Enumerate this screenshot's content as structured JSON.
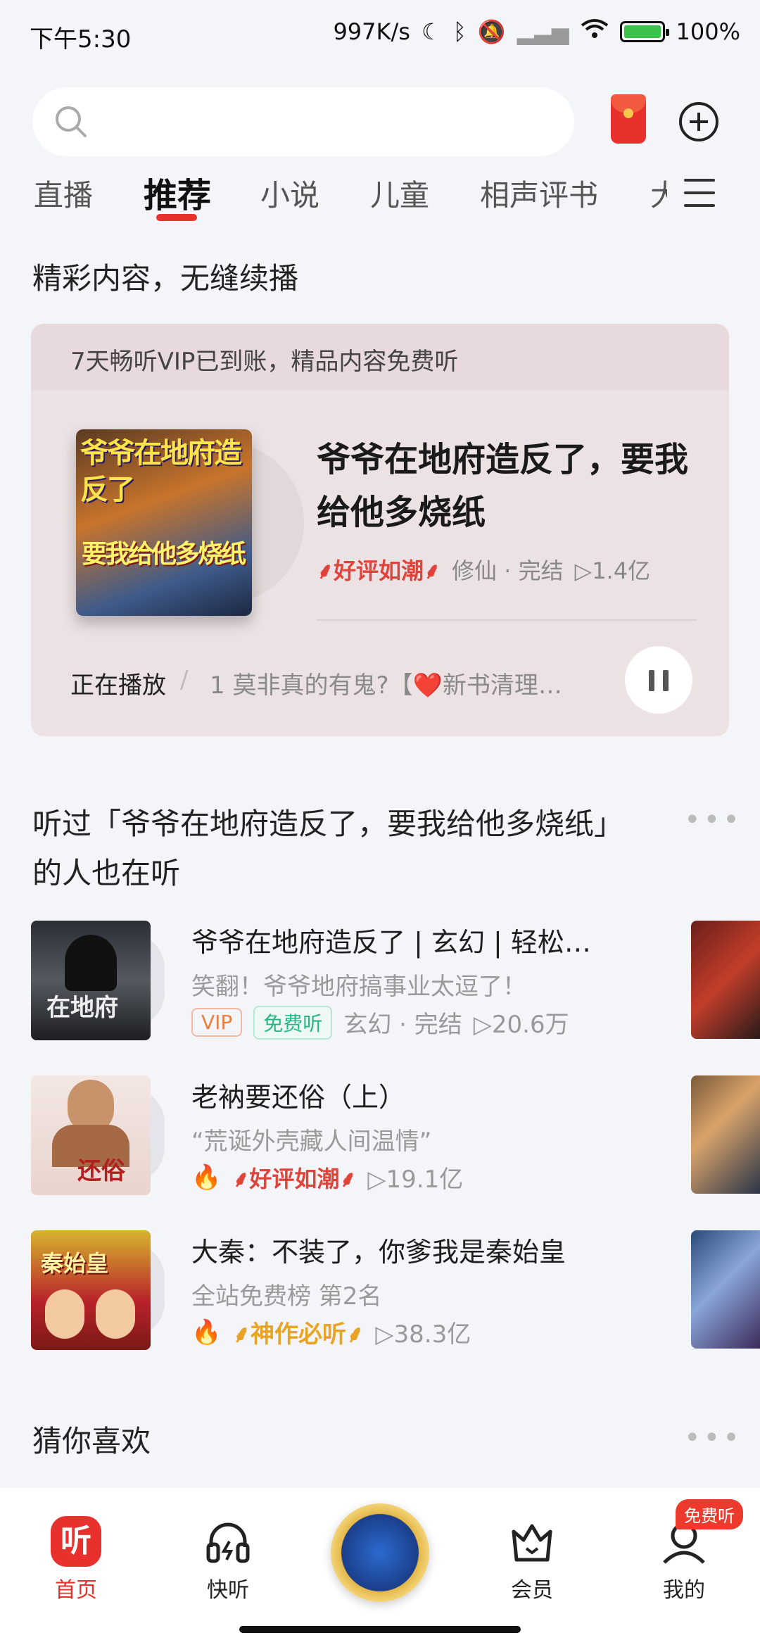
{
  "status_bar": {
    "time": "下午5:30",
    "speed": "997K/s",
    "battery": "100%"
  },
  "tabs": [
    "直播",
    "推荐",
    "小说",
    "儿童",
    "相声评书",
    "大"
  ],
  "active_tab": "推荐",
  "section1_title": "精彩内容，无缝续播",
  "featured": {
    "vip_notice": "7天畅听VIP已到账，精品内容免费听",
    "cover_text_top": "爷爷在地府造反了",
    "cover_text_bottom": "要我给他多烧纸",
    "title": "爷爷在地府造反了，要我给他多烧纸",
    "badge": "好评如潮",
    "genre": "修仙 · 完结",
    "plays": "1.4亿",
    "now_playing_label": "正在播放",
    "now_playing_track": "1 莫非真的有鬼?【❤️新书清理…"
  },
  "section2_title": "听过「爷爷在地府造反了，要我给他多烧纸」的人也在听",
  "recommendations": [
    {
      "title": "爷爷在地府造反了 | 玄幻 | 轻松…",
      "subtitle": "笑翻！爷爷地府搞事业太逗了！",
      "tag_vip": "VIP",
      "tag_free": "免费听",
      "genre": "玄幻 · 完结",
      "plays": "20.6万"
    },
    {
      "title": "老衲要还俗（上）",
      "subtitle": "“荒诞外壳藏人间温情”",
      "badge": "好评如潮",
      "plays": "19.1亿"
    },
    {
      "title": "大秦：不装了，你爹我是秦始皇",
      "subtitle": "全站免费榜 第2名",
      "badge": "神作必听",
      "plays": "38.3亿"
    }
  ],
  "section3_title": "猜你喜欢",
  "bottom_nav": {
    "home": "首页",
    "quick_listen": "快听",
    "member": "会员",
    "mine": "我的",
    "free_badge": "免费听",
    "home_glyph": "听"
  },
  "colors": {
    "accent": "#e8312c",
    "background": "#f4f5f9",
    "card": "#ece2e4"
  }
}
